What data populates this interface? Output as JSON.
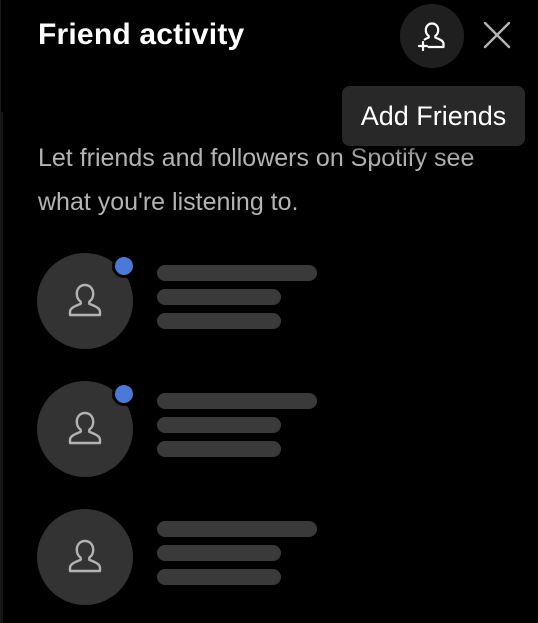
{
  "header": {
    "title": "Friend activity"
  },
  "tooltip": {
    "add_friends": "Add Friends"
  },
  "intro": {
    "text": "Let friends and followers on Spotify see what you're listening to."
  },
  "icons": {
    "add_friend": "person-plus-icon",
    "close": "close-icon",
    "avatar": "person-outline-icon"
  },
  "colors": {
    "background": "#000000",
    "online_dot": "#4a79d8",
    "placeholder_bar": "#3a3a3a",
    "avatar_bg": "#333333"
  },
  "friends": [
    {
      "online": true
    },
    {
      "online": true
    },
    {
      "online": false
    }
  ]
}
